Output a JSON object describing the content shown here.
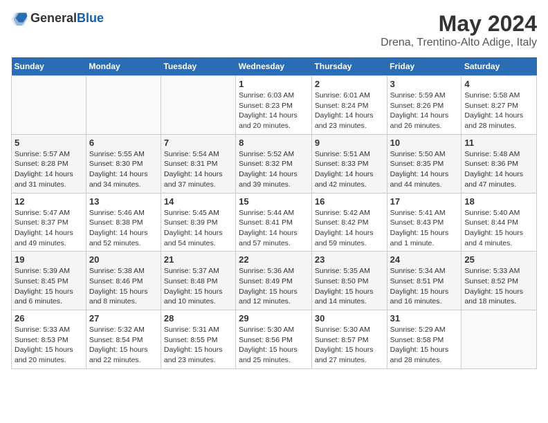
{
  "header": {
    "logo_general": "General",
    "logo_blue": "Blue",
    "month": "May 2024",
    "location": "Drena, Trentino-Alto Adige, Italy"
  },
  "weekdays": [
    "Sunday",
    "Monday",
    "Tuesday",
    "Wednesday",
    "Thursday",
    "Friday",
    "Saturday"
  ],
  "weeks": [
    [
      {
        "day": "",
        "info": ""
      },
      {
        "day": "",
        "info": ""
      },
      {
        "day": "",
        "info": ""
      },
      {
        "day": "1",
        "info": "Sunrise: 6:03 AM\nSunset: 8:23 PM\nDaylight: 14 hours\nand 20 minutes."
      },
      {
        "day": "2",
        "info": "Sunrise: 6:01 AM\nSunset: 8:24 PM\nDaylight: 14 hours\nand 23 minutes."
      },
      {
        "day": "3",
        "info": "Sunrise: 5:59 AM\nSunset: 8:26 PM\nDaylight: 14 hours\nand 26 minutes."
      },
      {
        "day": "4",
        "info": "Sunrise: 5:58 AM\nSunset: 8:27 PM\nDaylight: 14 hours\nand 28 minutes."
      }
    ],
    [
      {
        "day": "5",
        "info": "Sunrise: 5:57 AM\nSunset: 8:28 PM\nDaylight: 14 hours\nand 31 minutes."
      },
      {
        "day": "6",
        "info": "Sunrise: 5:55 AM\nSunset: 8:30 PM\nDaylight: 14 hours\nand 34 minutes."
      },
      {
        "day": "7",
        "info": "Sunrise: 5:54 AM\nSunset: 8:31 PM\nDaylight: 14 hours\nand 37 minutes."
      },
      {
        "day": "8",
        "info": "Sunrise: 5:52 AM\nSunset: 8:32 PM\nDaylight: 14 hours\nand 39 minutes."
      },
      {
        "day": "9",
        "info": "Sunrise: 5:51 AM\nSunset: 8:33 PM\nDaylight: 14 hours\nand 42 minutes."
      },
      {
        "day": "10",
        "info": "Sunrise: 5:50 AM\nSunset: 8:35 PM\nDaylight: 14 hours\nand 44 minutes."
      },
      {
        "day": "11",
        "info": "Sunrise: 5:48 AM\nSunset: 8:36 PM\nDaylight: 14 hours\nand 47 minutes."
      }
    ],
    [
      {
        "day": "12",
        "info": "Sunrise: 5:47 AM\nSunset: 8:37 PM\nDaylight: 14 hours\nand 49 minutes."
      },
      {
        "day": "13",
        "info": "Sunrise: 5:46 AM\nSunset: 8:38 PM\nDaylight: 14 hours\nand 52 minutes."
      },
      {
        "day": "14",
        "info": "Sunrise: 5:45 AM\nSunset: 8:39 PM\nDaylight: 14 hours\nand 54 minutes."
      },
      {
        "day": "15",
        "info": "Sunrise: 5:44 AM\nSunset: 8:41 PM\nDaylight: 14 hours\nand 57 minutes."
      },
      {
        "day": "16",
        "info": "Sunrise: 5:42 AM\nSunset: 8:42 PM\nDaylight: 14 hours\nand 59 minutes."
      },
      {
        "day": "17",
        "info": "Sunrise: 5:41 AM\nSunset: 8:43 PM\nDaylight: 15 hours\nand 1 minute."
      },
      {
        "day": "18",
        "info": "Sunrise: 5:40 AM\nSunset: 8:44 PM\nDaylight: 15 hours\nand 4 minutes."
      }
    ],
    [
      {
        "day": "19",
        "info": "Sunrise: 5:39 AM\nSunset: 8:45 PM\nDaylight: 15 hours\nand 6 minutes."
      },
      {
        "day": "20",
        "info": "Sunrise: 5:38 AM\nSunset: 8:46 PM\nDaylight: 15 hours\nand 8 minutes."
      },
      {
        "day": "21",
        "info": "Sunrise: 5:37 AM\nSunset: 8:48 PM\nDaylight: 15 hours\nand 10 minutes."
      },
      {
        "day": "22",
        "info": "Sunrise: 5:36 AM\nSunset: 8:49 PM\nDaylight: 15 hours\nand 12 minutes."
      },
      {
        "day": "23",
        "info": "Sunrise: 5:35 AM\nSunset: 8:50 PM\nDaylight: 15 hours\nand 14 minutes."
      },
      {
        "day": "24",
        "info": "Sunrise: 5:34 AM\nSunset: 8:51 PM\nDaylight: 15 hours\nand 16 minutes."
      },
      {
        "day": "25",
        "info": "Sunrise: 5:33 AM\nSunset: 8:52 PM\nDaylight: 15 hours\nand 18 minutes."
      }
    ],
    [
      {
        "day": "26",
        "info": "Sunrise: 5:33 AM\nSunset: 8:53 PM\nDaylight: 15 hours\nand 20 minutes."
      },
      {
        "day": "27",
        "info": "Sunrise: 5:32 AM\nSunset: 8:54 PM\nDaylight: 15 hours\nand 22 minutes."
      },
      {
        "day": "28",
        "info": "Sunrise: 5:31 AM\nSunset: 8:55 PM\nDaylight: 15 hours\nand 23 minutes."
      },
      {
        "day": "29",
        "info": "Sunrise: 5:30 AM\nSunset: 8:56 PM\nDaylight: 15 hours\nand 25 minutes."
      },
      {
        "day": "30",
        "info": "Sunrise: 5:30 AM\nSunset: 8:57 PM\nDaylight: 15 hours\nand 27 minutes."
      },
      {
        "day": "31",
        "info": "Sunrise: 5:29 AM\nSunset: 8:58 PM\nDaylight: 15 hours\nand 28 minutes."
      },
      {
        "day": "",
        "info": ""
      }
    ]
  ]
}
